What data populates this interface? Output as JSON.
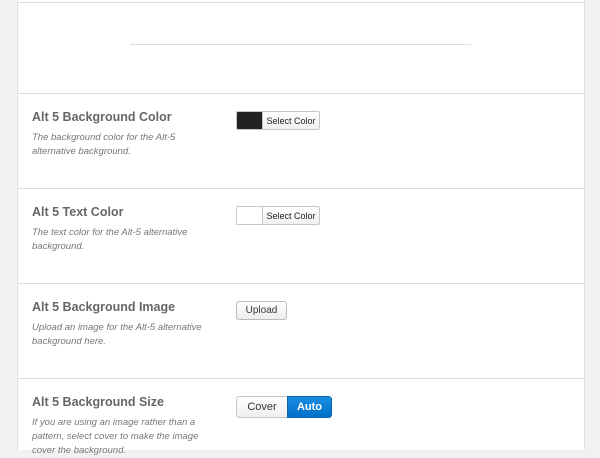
{
  "options": [
    {
      "title": "Alt 5 Background Color",
      "description": "The background color for the Alt-5 alternative background.",
      "swatch_color": "#222222",
      "button_label": "Select Color"
    },
    {
      "title": "Alt 5 Text Color",
      "description": "The text color for the Alt-5 alternative background.",
      "swatch_color": "#ffffff",
      "button_label": "Select Color"
    },
    {
      "title": "Alt 5 Background Image",
      "description": "Upload an image for the Alt-5 alternative background here.",
      "button_label": "Upload"
    },
    {
      "title": "Alt 5 Background Size",
      "description": "If you are using an image rather than a pattern, select cover to make the image cover the background.",
      "choices": [
        "Cover",
        "Auto"
      ],
      "selected": "Auto"
    }
  ],
  "colors": {
    "accent": "#0078d0",
    "page_background": "#f1f1f1",
    "panel_background": "#ffffff"
  }
}
